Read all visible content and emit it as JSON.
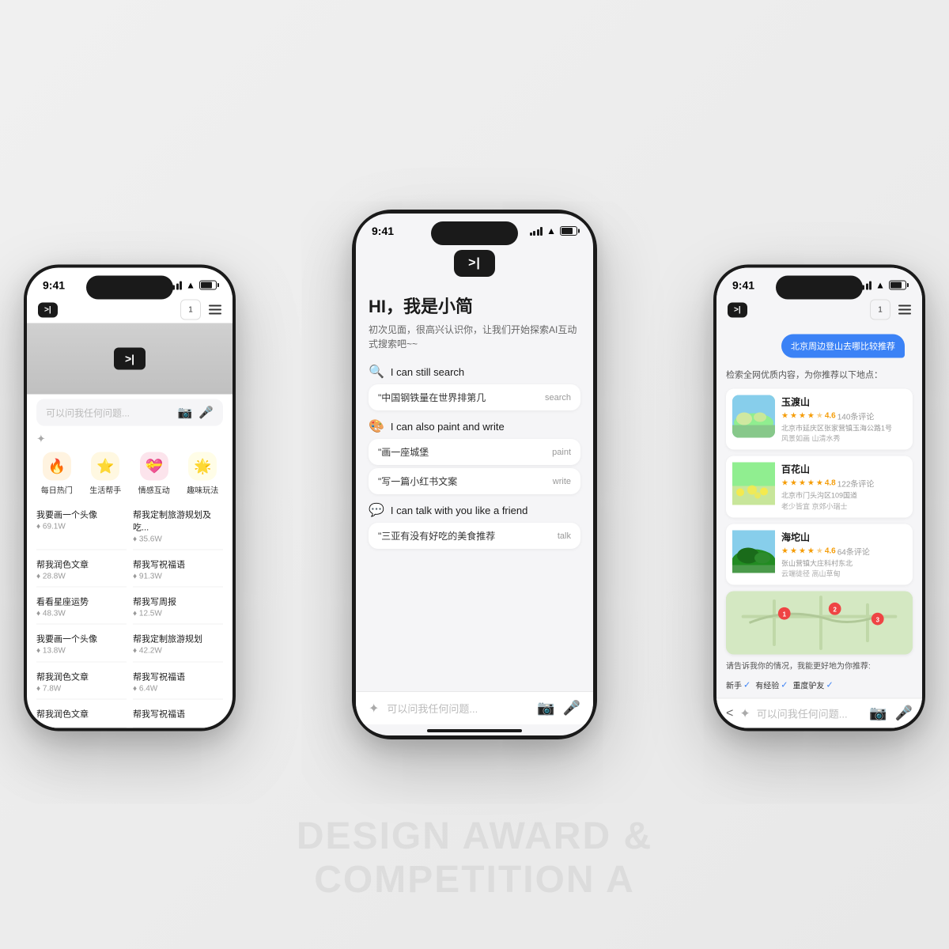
{
  "watermark": {
    "line1": "DESIGN AWARD &",
    "line2": "COMPETITION A"
  },
  "left_phone": {
    "status_time": "9:41",
    "app_logo": ">|",
    "icon_num": "1",
    "search_placeholder": "可以问我任何问题...",
    "categories": [
      {
        "label": "每日热门",
        "icon": "🔥",
        "color": "#fff0e0"
      },
      {
        "label": "生活帮手",
        "icon": "🌟",
        "color": "#fff5e0"
      },
      {
        "label": "情感互动",
        "icon": "💝",
        "color": "#ffe8f0"
      },
      {
        "label": "趣味玩法",
        "icon": "⭐",
        "color": "#fff8e0"
      }
    ],
    "grid_items": [
      {
        "title": "我要画一个头像",
        "count": "♦ 69.1W"
      },
      {
        "title": "帮我定制旅游规划及吃...",
        "count": "♦ 35.6W"
      },
      {
        "title": "帮我润色文章",
        "count": "♦ 28.8W"
      },
      {
        "title": "帮我写祝福语",
        "count": "♦ 91.3W"
      },
      {
        "title": "看看星座运势",
        "count": "♦ 48.3W"
      },
      {
        "title": "帮我写周报",
        "count": "♦ 12.5W"
      },
      {
        "title": "我要画一个头像",
        "count": "♦ 13.8W"
      },
      {
        "title": "帮我定制旅游规划",
        "count": "♦ 42.2W"
      },
      {
        "title": "帮我润色文章",
        "count": "♦ 7.8W"
      },
      {
        "title": "帮我写祝福语",
        "count": "♦ 6.4W"
      },
      {
        "title": "帮我润色文章",
        "count": ""
      },
      {
        "title": "帮我写祝福语",
        "count": ""
      }
    ]
  },
  "center_phone": {
    "status_time": "9:41",
    "app_logo": ">|",
    "greeting_title": "HI，我是小简",
    "greeting_sub": "初次见面，很高兴认识你，让我们开始探索AI互动\n式搜索吧~~",
    "features": [
      {
        "icon": "🔍",
        "label": "I can still search",
        "example": "\"中国钢铁量在世界排第几",
        "tag": "search"
      },
      {
        "icon": "🎨",
        "label": "I can also paint and write",
        "example": "\"画一座城堡",
        "tag": "paint"
      },
      {
        "icon": "",
        "label": "",
        "example": "\"写一篇小红书文案",
        "tag": "write"
      },
      {
        "icon": "💬",
        "label": "I can talk with you like a friend",
        "example": "\"三亚有没有好吃的美食推荐",
        "tag": "talk"
      }
    ],
    "input_placeholder": "可以问我任何问题..."
  },
  "right_phone": {
    "status_time": "9:41",
    "app_logo": ">|",
    "icon_num": "1",
    "user_query": "北京周边登山去哪比较推荐",
    "system_response": "检索全网优质内容，为你推荐以下地点：",
    "places": [
      {
        "name": "玉渡山",
        "rating": "4.6",
        "stars": 4.5,
        "reviews": "140条评论",
        "addr": "北京市延庆区张家营镇玉海公路1号",
        "tags": "风景如画  山清水秀"
      },
      {
        "name": "百花山",
        "rating": "4.8",
        "stars": 5,
        "reviews": "122条评论",
        "addr": "北京市门头沟区109国道",
        "tags": "老少皆宜  京郊小瑞士"
      },
      {
        "name": "海坨山",
        "rating": "4.6",
        "stars": 4.5,
        "reviews": "64条评论",
        "addr": "张山营镇大庄科村东北",
        "tags": "云端徒径  高山草甸"
      }
    ],
    "follow_up": "请告诉我你的情况，我能更好地为你推荐:",
    "levels": [
      "新手",
      "有经验",
      "重度驴友"
    ],
    "input_placeholder": "可以问我任何问题..."
  }
}
